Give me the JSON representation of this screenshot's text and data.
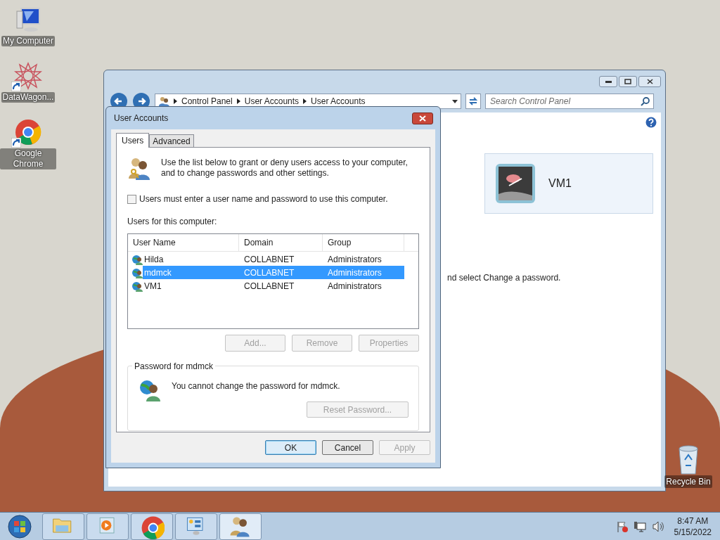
{
  "desktop_icons": [
    {
      "kind": "computer",
      "label": "My Computer",
      "shortcut": false
    },
    {
      "kind": "star",
      "label": "DataWagon...",
      "shortcut": true
    },
    {
      "kind": "chrome",
      "label": "Google Chrome",
      "shortcut": true
    }
  ],
  "recycle_bin": {
    "label": "Recycle Bin"
  },
  "control_panel": {
    "breadcrumb": [
      "Control Panel",
      "User Accounts",
      "User Accounts"
    ],
    "search": {
      "placeholder": "Search Control Panel"
    },
    "account_tile": "VM1",
    "body_text": "nd select Change a password."
  },
  "dialog": {
    "title": "User Accounts",
    "tabs": [
      {
        "label": "Users",
        "selected": true
      },
      {
        "label": "Advanced",
        "selected": false
      }
    ],
    "intro": "Use the list below to grant or deny users access to your computer, and to change passwords and other settings.",
    "require_password": {
      "label": "Users must enter a user name and password to use this computer.",
      "checked": false
    },
    "list_label": "Users for this computer:",
    "columns": [
      "User Name",
      "Domain",
      "Group"
    ],
    "rows": [
      {
        "cells": [
          "Hilda",
          "COLLABNET",
          "Administrators"
        ],
        "selected": false
      },
      {
        "cells": [
          "mdmck",
          "COLLABNET",
          "Administrators"
        ],
        "selected": true
      },
      {
        "cells": [
          "VM1",
          "COLLABNET",
          "Administrators"
        ],
        "selected": false
      }
    ],
    "list_buttons": [
      {
        "label": "Add...",
        "disabled": true
      },
      {
        "label": "Remove",
        "disabled": true
      },
      {
        "label": "Properties",
        "disabled": true
      }
    ],
    "password_group": {
      "title": "Password for mdmck",
      "message": "You cannot change the password for mdmck.",
      "button": {
        "label": "Reset Password...",
        "disabled": true
      }
    },
    "footer_buttons": [
      {
        "label": "OK",
        "default": true,
        "disabled": false
      },
      {
        "label": "Cancel",
        "default": false,
        "disabled": false
      },
      {
        "label": "Apply",
        "default": false,
        "disabled": true
      }
    ]
  },
  "taskbar": {
    "apps": [
      {
        "kind": "folder"
      },
      {
        "kind": "media"
      },
      {
        "kind": "chrome"
      },
      {
        "kind": "panel"
      },
      {
        "kind": "users"
      }
    ],
    "time": "8:47 AM",
    "date": "5/15/2022"
  }
}
